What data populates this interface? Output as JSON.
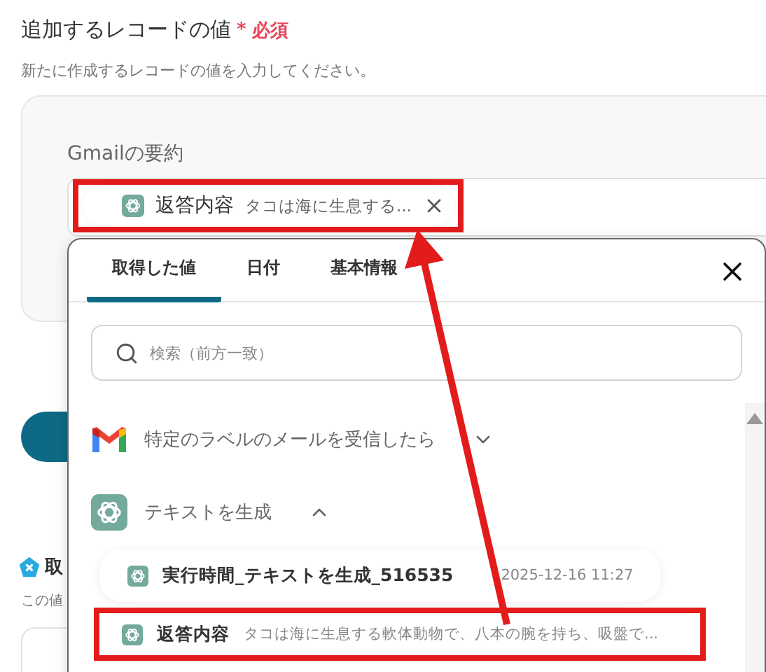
{
  "field": {
    "title": "追加するレコードの値",
    "required_mark": "*",
    "required_label": "必須",
    "description": "新たに作成するレコードの値を入力してください。"
  },
  "card": {
    "label": "Gmailの要約",
    "token": {
      "name": "返答内容",
      "preview": "タコは海に生息する...",
      "highlighted": true
    }
  },
  "next_section": {
    "title": "取",
    "description": "この値"
  },
  "popup": {
    "tabs": [
      {
        "label": "取得した値",
        "selected": true
      },
      {
        "label": "日付",
        "selected": false
      },
      {
        "label": "基本情報",
        "selected": false
      }
    ],
    "search": {
      "placeholder": "検索（前方一致）"
    },
    "groups": [
      {
        "kind": "gmail",
        "title": "特定のラベルのメールを受信したら",
        "expanded": false
      },
      {
        "kind": "chatgpt",
        "title": "テキストを生成",
        "expanded": true,
        "items": [
          {
            "name": "実行時間_テキストを生成_516535",
            "value": "2025-12-16 11:27",
            "highlighted": false
          },
          {
            "name": "返答内容",
            "value": "タコは海に生息する軟体動物で、八本の腕を持ち、吸盤で...",
            "highlighted": true
          }
        ]
      }
    ]
  }
}
